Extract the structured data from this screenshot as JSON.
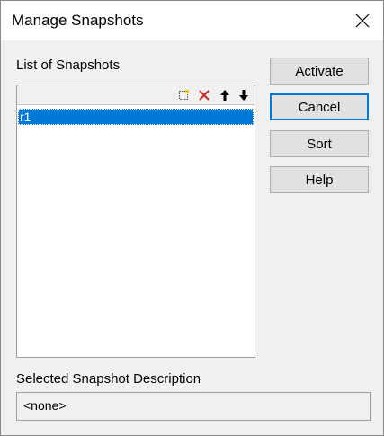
{
  "window": {
    "title": "Manage Snapshots"
  },
  "list": {
    "label": "List of Snapshots",
    "items": [
      "r1"
    ],
    "toolbar": {
      "new_icon": "new-item-icon",
      "delete_icon": "delete-icon",
      "up_icon": "arrow-up-icon",
      "down_icon": "arrow-down-icon"
    }
  },
  "buttons": {
    "activate": "Activate",
    "cancel": "Cancel",
    "sort": "Sort",
    "help": "Help"
  },
  "description": {
    "label": "Selected Snapshot Description",
    "value": "<none>"
  },
  "colors": {
    "selection": "#0078d7",
    "delete_icon": "#c42b1c",
    "dialog_bg": "#f0f0f0"
  }
}
